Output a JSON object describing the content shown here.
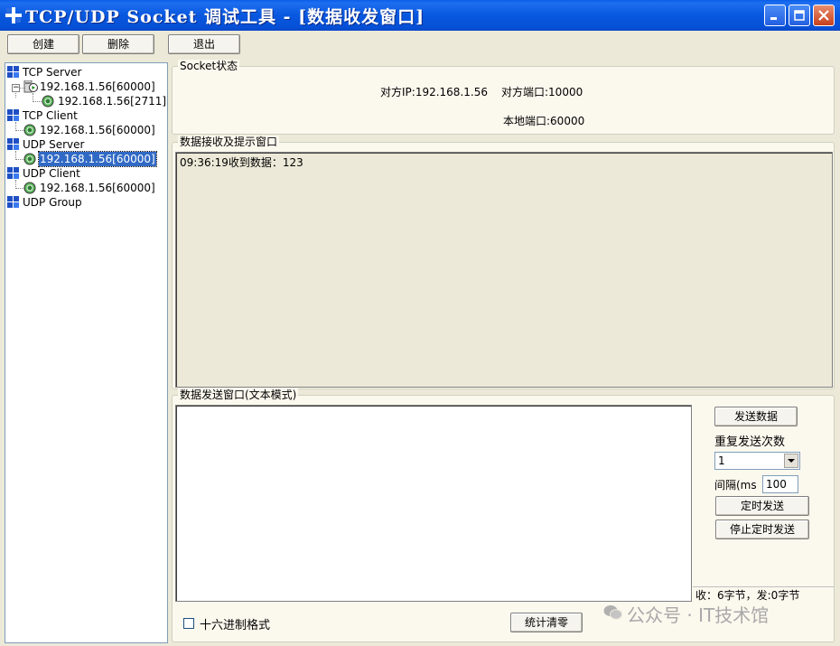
{
  "window": {
    "title": "TCP/UDP Socket 调试工具 - [数据收发窗口]",
    "icon": "app-grid-icon"
  },
  "toolbar": {
    "create_label": "创建",
    "delete_label": "删除",
    "exit_label": "退出"
  },
  "tree": {
    "tcp_server": {
      "label": "TCP Server",
      "children": [
        {
          "label": "192.168.1.56[60000]",
          "children": [
            {
              "label": "192.168.1.56[2711]"
            }
          ]
        }
      ]
    },
    "tcp_client": {
      "label": "TCP Client",
      "children": [
        {
          "label": "192.168.1.56[60000]"
        }
      ]
    },
    "udp_server": {
      "label": "UDP Server",
      "children": [
        {
          "label": "192.168.1.56[60000]",
          "selected": true
        }
      ]
    },
    "udp_client": {
      "label": "UDP Client",
      "children": [
        {
          "label": "192.168.1.56[60000]"
        }
      ]
    },
    "udp_group": {
      "label": "UDP Group"
    }
  },
  "socket_status": {
    "title": "Socket状态",
    "peer_ip": "对方IP:192.168.1.56",
    "peer_port": "对方端口:10000",
    "local_port": "本地端口:60000"
  },
  "receive": {
    "title": "数据接收及提示窗口",
    "lines": [
      "09:36:19收到数据：123"
    ]
  },
  "send": {
    "title": "数据发送窗口(文本模式)",
    "send_button": "发送数据",
    "repeat_label": "重复发送次数",
    "repeat_value": "1",
    "interval_label": "间隔(ms",
    "interval_value": "100",
    "timed_send_button": "定时发送",
    "stop_timed_send_button": "停止定时发送",
    "stats": "收：6字节，发:0字节",
    "hex_label": "十六进制格式",
    "clear_stats_button": "统计清零"
  },
  "watermark": "公众号 · IT技术馆"
}
